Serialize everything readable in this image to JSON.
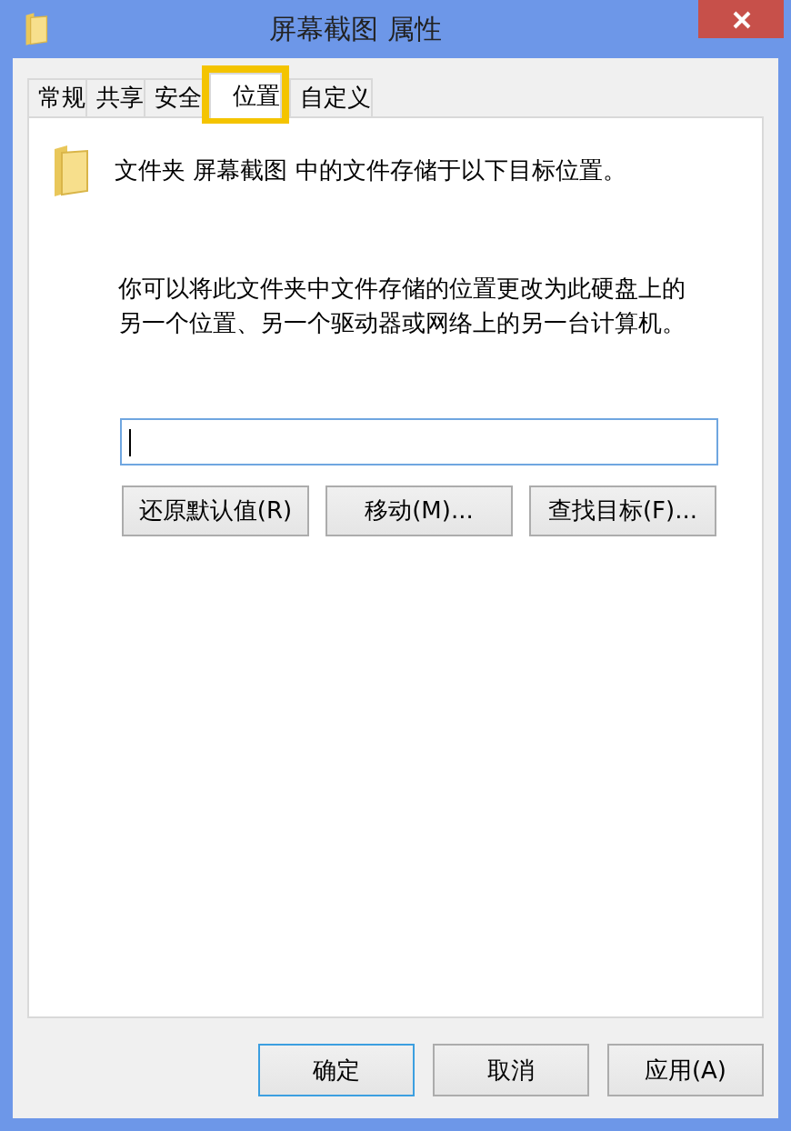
{
  "window": {
    "title": "屏幕截图 属性"
  },
  "tabs": [
    {
      "label": "常规",
      "selected": false,
      "highlighted": false
    },
    {
      "label": "共享",
      "selected": false,
      "highlighted": false
    },
    {
      "label": "安全",
      "selected": false,
      "highlighted": false
    },
    {
      "label": "位置",
      "selected": true,
      "highlighted": true
    },
    {
      "label": "自定义",
      "selected": false,
      "highlighted": false
    }
  ],
  "header_text": "文件夹 屏幕截图 中的文件存储于以下目标位置。",
  "description": "你可以将此文件夹中文件存储的位置更改为此硬盘上的另一个位置、另一个驱动器或网络上的另一台计算机。",
  "location_field": {
    "focused": true
  },
  "action_buttons": [
    {
      "label": "还原默认值(R)"
    },
    {
      "label": "移动(M)..."
    },
    {
      "label": "查找目标(F)..."
    }
  ],
  "dialog_buttons": [
    {
      "label": "确定",
      "default": true
    },
    {
      "label": "取消",
      "default": false
    },
    {
      "label": "应用(A)",
      "default": false
    }
  ]
}
